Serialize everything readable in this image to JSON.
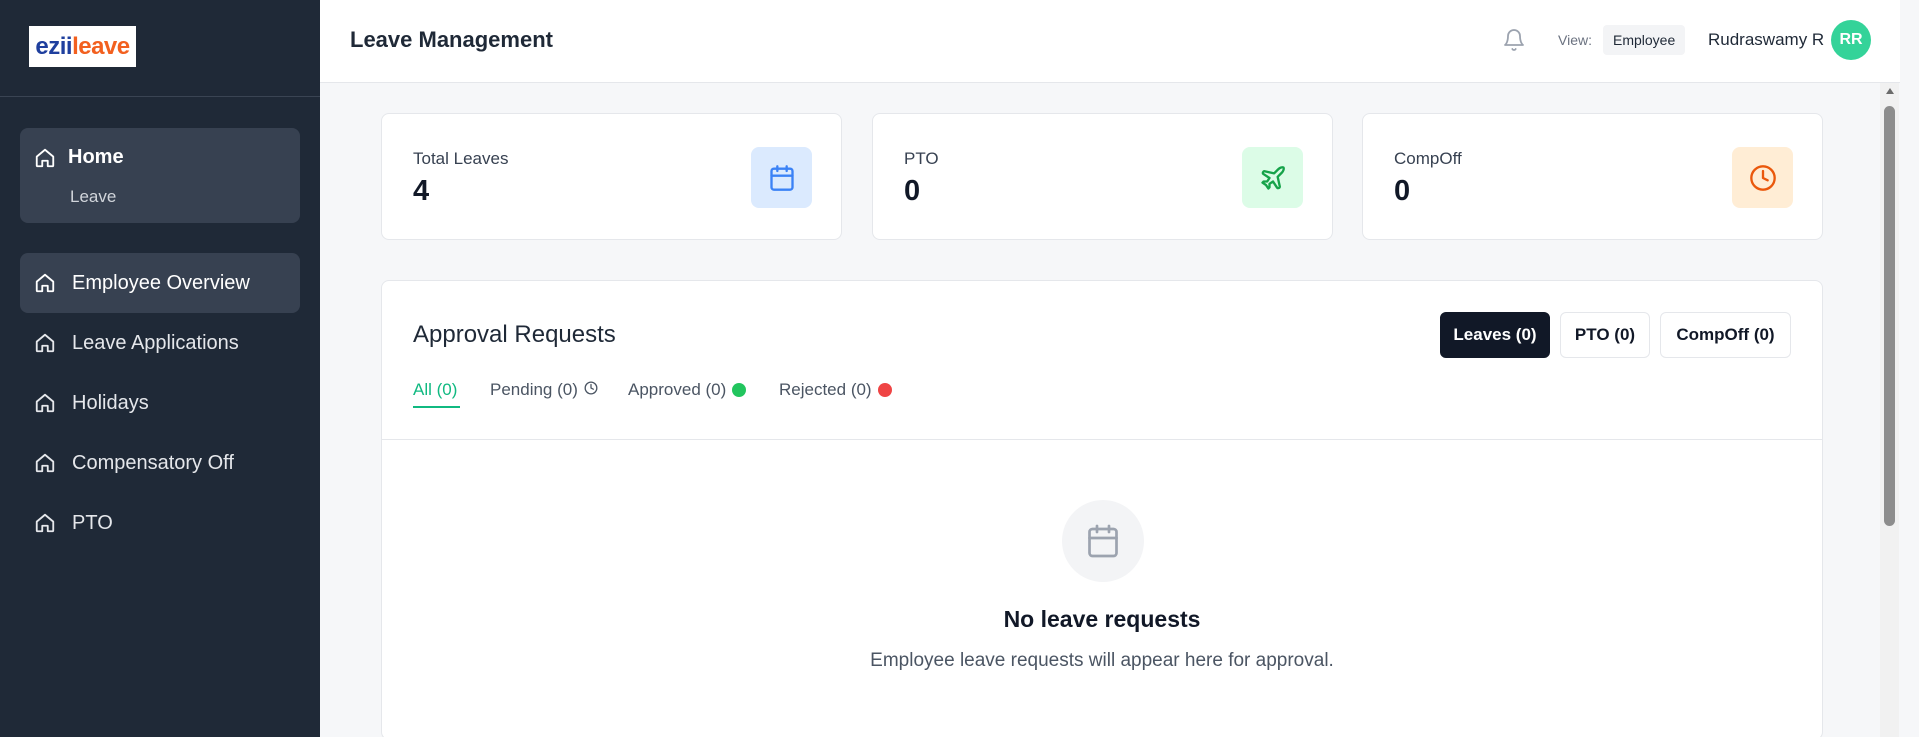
{
  "logo": {
    "part1": "ezii",
    "part2": "leave"
  },
  "sidebar": {
    "home": {
      "label": "Home",
      "sub": "Leave"
    },
    "items": [
      {
        "label": "Employee Overview",
        "active": true
      },
      {
        "label": "Leave Applications"
      },
      {
        "label": "Holidays"
      },
      {
        "label": "Compensatory Off"
      },
      {
        "label": "PTO"
      }
    ]
  },
  "header": {
    "title": "Leave Management",
    "view_label": "View:",
    "view_value": "Employee",
    "user_name": "Rudraswamy R",
    "avatar_initials": "RR"
  },
  "stats": [
    {
      "label": "Total Leaves",
      "value": "4",
      "icon": "calendar-icon",
      "color": "#3b82f6",
      "bg": "#dbeafe"
    },
    {
      "label": "PTO",
      "value": "0",
      "icon": "plane-icon",
      "color": "#16a34a",
      "bg": "#dcfce7"
    },
    {
      "label": "CompOff",
      "value": "0",
      "icon": "clock-icon",
      "color": "#ea580c",
      "bg": "#ffedd5"
    }
  ],
  "approvals": {
    "title": "Approval Requests",
    "type_buttons": [
      {
        "label": "Leaves (0)",
        "active": true
      },
      {
        "label": "PTO (0)"
      },
      {
        "label": "CompOff (0)"
      }
    ],
    "tabs": [
      {
        "label": "All (0)",
        "active": true
      },
      {
        "label": "Pending (0)",
        "indicator": "clock-icon"
      },
      {
        "label": "Approved (0)",
        "indicator": "green-dot",
        "color": "#22c55e"
      },
      {
        "label": "Rejected (0)",
        "indicator": "red-dot",
        "color": "#ef4444"
      }
    ],
    "empty": {
      "icon": "calendar-icon",
      "title": "No leave requests",
      "description": "Employee leave requests will appear here for approval."
    }
  },
  "colors": {
    "sidebar_bg": "#1f2937",
    "accent": "#10b981",
    "avatar": "#34d399"
  }
}
